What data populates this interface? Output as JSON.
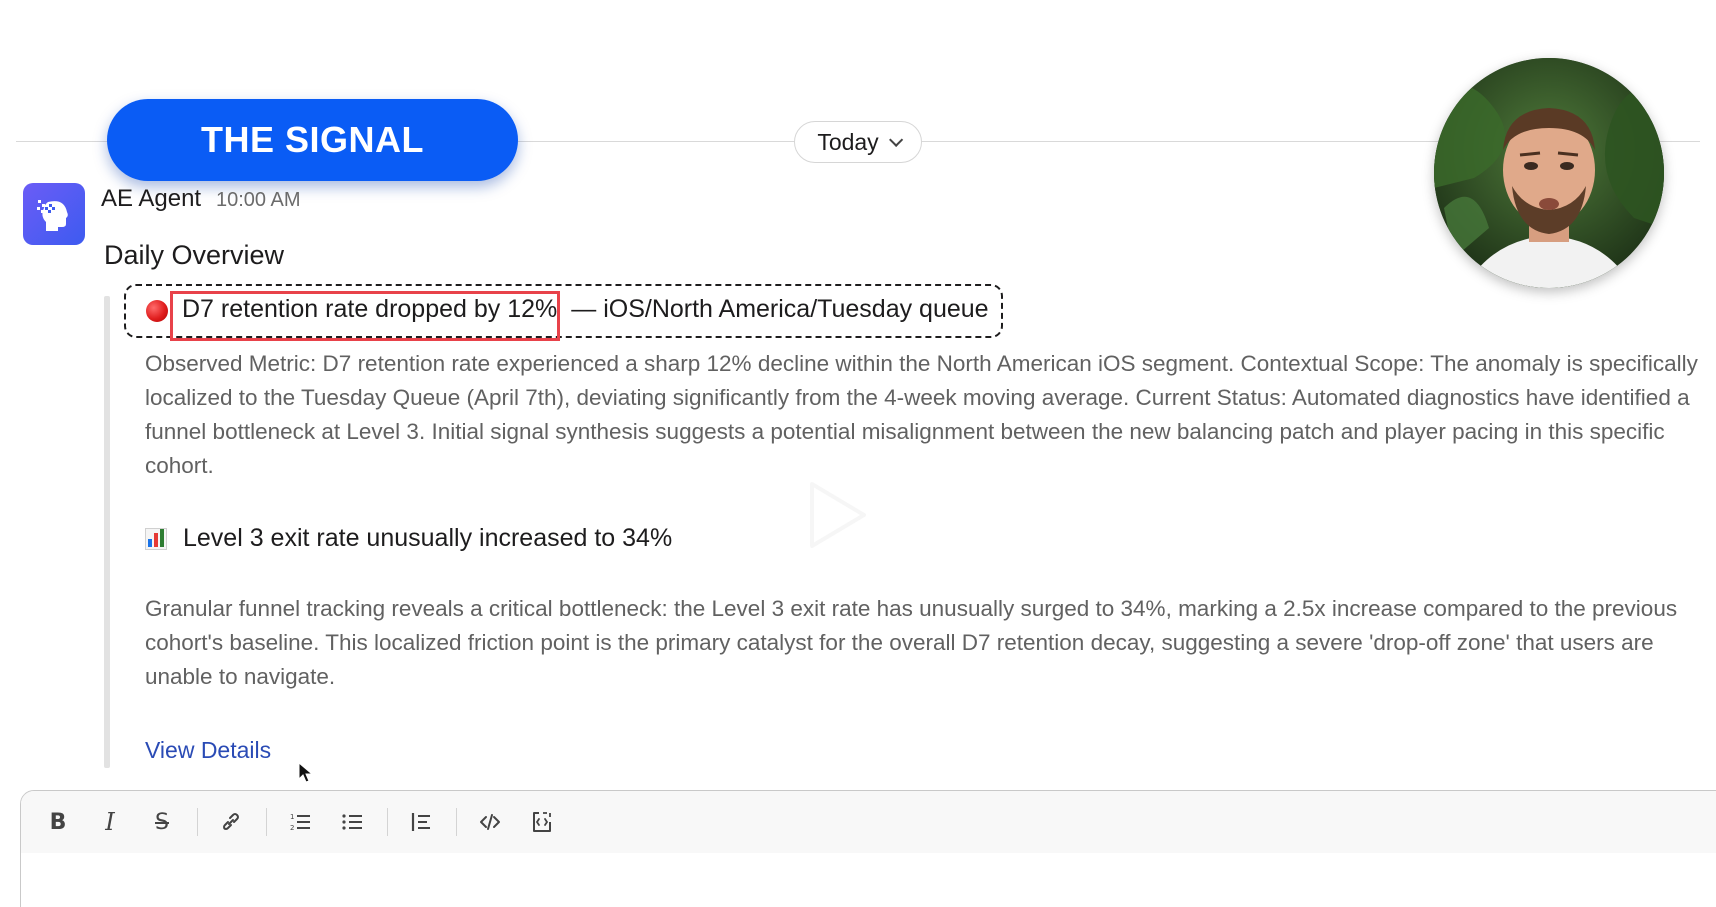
{
  "brand": {
    "title": "THE SIGNAL"
  },
  "date_divider": {
    "label": "Today"
  },
  "message": {
    "sender": "AE Agent",
    "time": "10:00 AM",
    "title": "Daily Overview",
    "alert": {
      "headline": "D7 retention rate dropped by 12%",
      "context": "— iOS/North America/Tuesday queue"
    },
    "observation": "Observed Metric: D7 retention rate experienced a sharp 12% decline within the North American iOS segment. Contextual Scope: The anomaly is specifically localized to the Tuesday Queue (April 7th), deviating significantly from the 4-week moving average. Current Status: Automated diagnostics have identified a funnel bottleneck at Level 3. Initial signal synthesis suggests a potential misalignment between the new balancing patch and player pacing in this specific cohort.",
    "metric": {
      "label": "Level 3 exit rate unusually increased to 34%",
      "icon": "bar-chart-icon"
    },
    "analysis": "Granular funnel tracking reveals a critical bottleneck: the Level 3 exit rate has unusually surged to 34%, marking a 2.5x increase compared to the previous cohort's baseline. This localized friction point is the primary catalyst for the overall D7 retention decay, suggesting a severe 'drop-off zone' that users are unable to navigate.",
    "link": "View Details"
  },
  "composer": {
    "toolbar": [
      {
        "name": "bold-button",
        "icon": "bold-icon"
      },
      {
        "name": "italic-button",
        "icon": "italic-icon"
      },
      {
        "name": "strikethrough-button",
        "icon": "strikethrough-icon"
      },
      {
        "name": "link-button",
        "icon": "link-icon"
      },
      {
        "name": "ordered-list-button",
        "icon": "ordered-list-icon"
      },
      {
        "name": "bulleted-list-button",
        "icon": "bulleted-list-icon"
      },
      {
        "name": "blockquote-button",
        "icon": "blockquote-icon"
      },
      {
        "name": "code-button",
        "icon": "code-icon"
      },
      {
        "name": "code-block-button",
        "icon": "code-block-icon"
      }
    ]
  },
  "colors": {
    "brand_blue": "#0a5cf5",
    "alert_red": "#e8424a",
    "link_blue": "#2a4bb5",
    "agent_icon": "#5a5cf4"
  }
}
